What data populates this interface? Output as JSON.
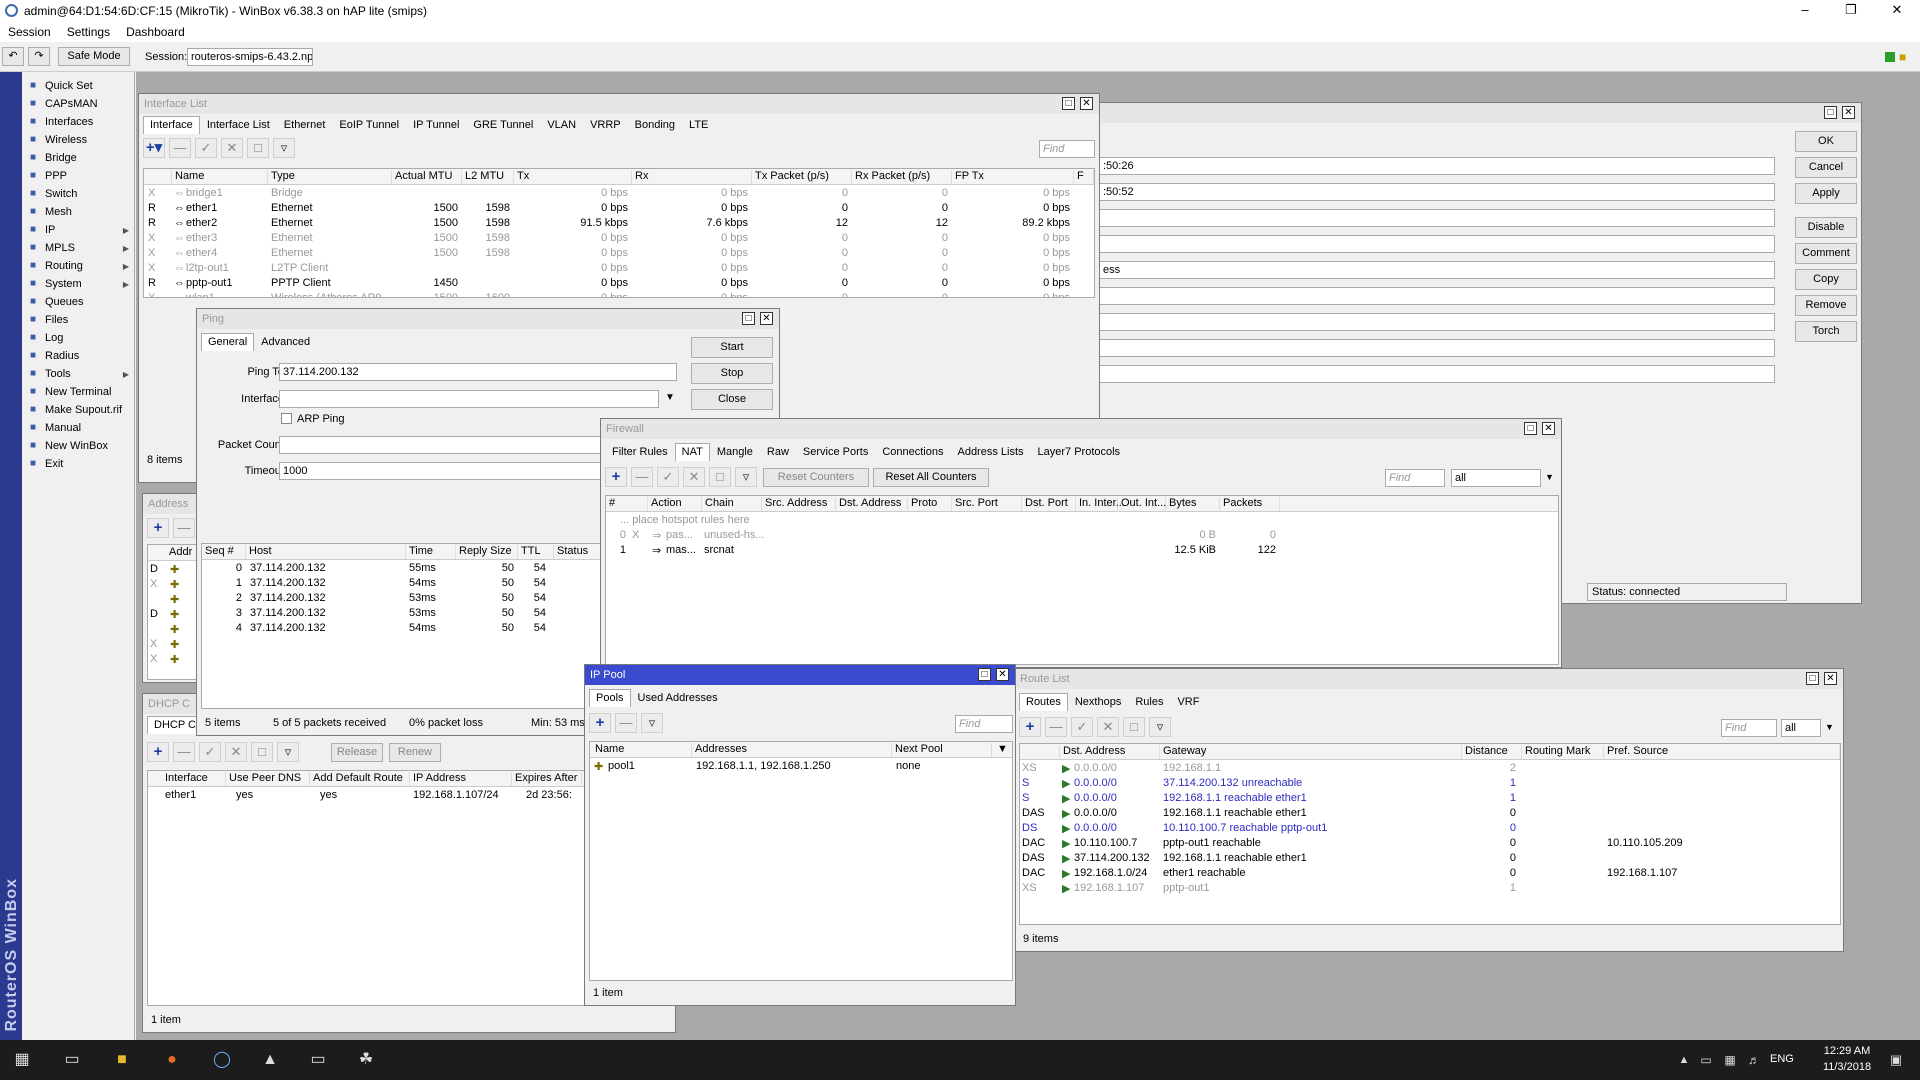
{
  "app": {
    "title": "admin@64:D1:54:6D:CF:15 (MikroTik) - WinBox v6.38.3 on hAP lite (smips)",
    "menu": [
      "Session",
      "Settings",
      "Dashboard"
    ],
    "safe_mode": "Safe Mode",
    "session_label": "Session:",
    "session_value": "routeros-smips-6.43.2.npk",
    "brand_vertical": "RouterOS WinBox"
  },
  "sidebar": {
    "items": [
      {
        "label": "Quick Set",
        "icon": "wand-icon",
        "sub": false
      },
      {
        "label": "CAPsMAN",
        "icon": "antenna-icon",
        "sub": false
      },
      {
        "label": "Interfaces",
        "icon": "interfaces-icon",
        "sub": false
      },
      {
        "label": "Wireless",
        "icon": "wireless-icon",
        "sub": false
      },
      {
        "label": "Bridge",
        "icon": "bridge-icon",
        "sub": false
      },
      {
        "label": "PPP",
        "icon": "ppp-icon",
        "sub": false
      },
      {
        "label": "Switch",
        "icon": "switch-icon",
        "sub": false
      },
      {
        "label": "Mesh",
        "icon": "mesh-icon",
        "sub": false
      },
      {
        "label": "IP",
        "icon": "ip-icon",
        "sub": true
      },
      {
        "label": "MPLS",
        "icon": "mpls-icon",
        "sub": true
      },
      {
        "label": "Routing",
        "icon": "routing-icon",
        "sub": true
      },
      {
        "label": "System",
        "icon": "gear-icon",
        "sub": true
      },
      {
        "label": "Queues",
        "icon": "queues-icon",
        "sub": false
      },
      {
        "label": "Files",
        "icon": "folder-icon",
        "sub": false
      },
      {
        "label": "Log",
        "icon": "log-icon",
        "sub": false
      },
      {
        "label": "Radius",
        "icon": "radius-icon",
        "sub": false
      },
      {
        "label": "Tools",
        "icon": "tools-icon",
        "sub": true
      },
      {
        "label": "New Terminal",
        "icon": "terminal-icon",
        "sub": false
      },
      {
        "label": "Make Supout.rif",
        "icon": "supout-icon",
        "sub": false
      },
      {
        "label": "Manual",
        "icon": "manual-icon",
        "sub": false
      },
      {
        "label": "New WinBox",
        "icon": "winbox-icon",
        "sub": false
      },
      {
        "label": "Exit",
        "icon": "exit-icon",
        "sub": false
      }
    ]
  },
  "interface_list": {
    "title": "Interface List",
    "tabs": [
      "Interface",
      "Interface List",
      "Ethernet",
      "EoIP Tunnel",
      "IP Tunnel",
      "GRE Tunnel",
      "VLAN",
      "VRRP",
      "Bonding",
      "LTE"
    ],
    "find": "Find",
    "columns": [
      "Name",
      "Type",
      "Actual MTU",
      "L2 MTU",
      "Tx",
      "Rx",
      "Tx Packet (p/s)",
      "Rx Packet (p/s)",
      "FP Tx",
      "F"
    ],
    "rows": [
      {
        "flag": "X",
        "name": "bridge1",
        "type": "Bridge",
        "mtu": "",
        "l2": "",
        "tx": "0 bps",
        "rx": "0 bps",
        "txp": "0",
        "rxp": "0",
        "fptx": "0 bps",
        "dis": true
      },
      {
        "flag": "R",
        "name": "ether1",
        "type": "Ethernet",
        "mtu": "1500",
        "l2": "1598",
        "tx": "0 bps",
        "rx": "0 bps",
        "txp": "0",
        "rxp": "0",
        "fptx": "0 bps",
        "dis": false
      },
      {
        "flag": "R",
        "name": "ether2",
        "type": "Ethernet",
        "mtu": "1500",
        "l2": "1598",
        "tx": "91.5 kbps",
        "rx": "7.6 kbps",
        "txp": "12",
        "rxp": "12",
        "fptx": "89.2 kbps",
        "dis": false
      },
      {
        "flag": "X",
        "name": "ether3",
        "type": "Ethernet",
        "mtu": "1500",
        "l2": "1598",
        "tx": "0 bps",
        "rx": "0 bps",
        "txp": "0",
        "rxp": "0",
        "fptx": "0 bps",
        "dis": true
      },
      {
        "flag": "X",
        "name": "ether4",
        "type": "Ethernet",
        "mtu": "1500",
        "l2": "1598",
        "tx": "0 bps",
        "rx": "0 bps",
        "txp": "0",
        "rxp": "0",
        "fptx": "0 bps",
        "dis": true
      },
      {
        "flag": "X",
        "name": "l2tp-out1",
        "type": "L2TP Client",
        "mtu": "",
        "l2": "",
        "tx": "0 bps",
        "rx": "0 bps",
        "txp": "0",
        "rxp": "0",
        "fptx": "0 bps",
        "dis": true
      },
      {
        "flag": "R",
        "name": "pptp-out1",
        "type": "PPTP Client",
        "mtu": "1450",
        "l2": "",
        "tx": "0 bps",
        "rx": "0 bps",
        "txp": "0",
        "rxp": "0",
        "fptx": "0 bps",
        "dis": false
      },
      {
        "flag": "X",
        "name": "wlan1",
        "type": "Wireless (Atheros AR9...",
        "mtu": "1500",
        "l2": "1600",
        "tx": "0 bps",
        "rx": "0 bps",
        "txp": "0",
        "rxp": "0",
        "fptx": "0 bps",
        "dis": true
      }
    ],
    "status": "8 items"
  },
  "right_panel": {
    "values": [
      ":50:26",
      ":50:52",
      "ess"
    ],
    "buttons": [
      "OK",
      "Cancel",
      "Apply",
      "Disable",
      "Comment",
      "Copy",
      "Remove",
      "Torch"
    ],
    "status": "Status: connected"
  },
  "ping": {
    "title": "Ping",
    "tabs": [
      "General",
      "Advanced"
    ],
    "ping_to_label": "Ping To:",
    "ping_to": "37.114.200.132",
    "interface_label": "Interface:",
    "arp_ping": "ARP Ping",
    "packet_count_label": "Packet Count:",
    "timeout_label": "Timeout:",
    "timeout": "1000",
    "buttons": [
      "Start",
      "Stop",
      "Close"
    ],
    "columns": [
      "Seq #",
      "Host",
      "Time",
      "Reply Size",
      "TTL",
      "Status"
    ],
    "rows": [
      {
        "seq": "0",
        "host": "37.114.200.132",
        "time": "55ms",
        "size": "50",
        "ttl": "54"
      },
      {
        "seq": "1",
        "host": "37.114.200.132",
        "time": "54ms",
        "size": "50",
        "ttl": "54"
      },
      {
        "seq": "2",
        "host": "37.114.200.132",
        "time": "53ms",
        "size": "50",
        "ttl": "54"
      },
      {
        "seq": "3",
        "host": "37.114.200.132",
        "time": "53ms",
        "size": "50",
        "ttl": "54"
      },
      {
        "seq": "4",
        "host": "37.114.200.132",
        "time": "54ms",
        "size": "50",
        "ttl": "54"
      }
    ],
    "status": [
      "5 items",
      "5 of 5 packets received",
      "0% packet loss",
      "Min: 53 ms"
    ]
  },
  "address_list": {
    "title": "Address",
    "col": "Addr",
    "flags": [
      "D",
      "X",
      "",
      "D",
      "",
      "X",
      "X"
    ]
  },
  "dhcp": {
    "title": "DHCP C",
    "tab": "DHCP C",
    "release": "Release",
    "renew": "Renew",
    "columns": [
      "Interface",
      "Use Peer DNS",
      "Add Default Route",
      "IP Address",
      "Expires After"
    ],
    "row": {
      "iface": "ether1",
      "dns": "yes",
      "route": "yes",
      "ip": "192.168.1.107/24",
      "exp": "2d 23:56:"
    },
    "status": "1 item"
  },
  "firewall": {
    "title": "Firewall",
    "tabs": [
      "Filter Rules",
      "NAT",
      "Mangle",
      "Raw",
      "Service Ports",
      "Connections",
      "Address Lists",
      "Layer7 Protocols"
    ],
    "reset_counters": "Reset Counters",
    "reset_all": "Reset All Counters",
    "find": "Find",
    "filter": "all",
    "columns": [
      "#",
      "Action",
      "Chain",
      "Src. Address",
      "Dst. Address",
      "Proto",
      "Src. Port",
      "Dst. Port",
      "In. Inter...",
      "Out. Int...",
      "Bytes",
      "Packets"
    ],
    "comment": "... place hotspot rules here",
    "rows": [
      {
        "num": "0",
        "flag": "X",
        "action": "pas...",
        "chain": "unused-hs...",
        "bytes": "0 B",
        "packets": "0",
        "dis": true
      },
      {
        "num": "1",
        "flag": "",
        "action": "mas...",
        "chain": "srcnat",
        "bytes": "12.5 KiB",
        "packets": "122",
        "dis": false
      }
    ]
  },
  "ip_pool": {
    "title": "IP Pool",
    "tabs": [
      "Pools",
      "Used Addresses"
    ],
    "find": "Find",
    "columns": [
      "Name",
      "Addresses",
      "Next Pool"
    ],
    "row": {
      "name": "pool1",
      "addresses": "192.168.1.1, 192.168.1.250",
      "next": "none"
    },
    "status": "1 item"
  },
  "route_list": {
    "title": "Route List",
    "tabs": [
      "Routes",
      "Nexthops",
      "Rules",
      "VRF"
    ],
    "find": "Find",
    "filter": "all",
    "columns": [
      "Dst. Address",
      "Gateway",
      "Distance",
      "Routing Mark",
      "Pref. Source"
    ],
    "rows": [
      {
        "flag": "XS",
        "dst": "0.0.0.0/0",
        "gw": "192.168.1.1",
        "dist": "2",
        "mark": "",
        "pref": "",
        "style": "dis"
      },
      {
        "flag": "S",
        "dst": "0.0.0.0/0",
        "gw": "37.114.200.132 unreachable",
        "dist": "1",
        "mark": "",
        "pref": "",
        "style": "blue"
      },
      {
        "flag": "S",
        "dst": "0.0.0.0/0",
        "gw": "192.168.1.1 reachable ether1",
        "dist": "1",
        "mark": "",
        "pref": "",
        "style": "blue"
      },
      {
        "flag": "DAS",
        "dst": "0.0.0.0/0",
        "gw": "192.168.1.1 reachable ether1",
        "dist": "0",
        "mark": "",
        "pref": "",
        "style": ""
      },
      {
        "flag": "DS",
        "dst": "0.0.0.0/0",
        "gw": "10.110.100.7 reachable pptp-out1",
        "dist": "0",
        "mark": "",
        "pref": "",
        "style": "blue"
      },
      {
        "flag": "DAC",
        "dst": "10.110.100.7",
        "gw": "pptp-out1 reachable",
        "dist": "0",
        "mark": "",
        "pref": "10.110.105.209",
        "style": ""
      },
      {
        "flag": "DAS",
        "dst": "37.114.200.132",
        "gw": "192.168.1.1 reachable ether1",
        "dist": "0",
        "mark": "",
        "pref": "",
        "style": ""
      },
      {
        "flag": "DAC",
        "dst": "192.168.1.0/24",
        "gw": "ether1 reachable",
        "dist": "0",
        "mark": "",
        "pref": "192.168.1.107",
        "style": ""
      },
      {
        "flag": "XS",
        "dst": "192.168.1.107",
        "gw": "pptp-out1",
        "dist": "1",
        "mark": "",
        "pref": "",
        "style": "dis"
      }
    ],
    "status": "9 items"
  },
  "taskbar": {
    "lang": "ENG",
    "time": "12:29 AM",
    "date": "11/3/2018"
  }
}
